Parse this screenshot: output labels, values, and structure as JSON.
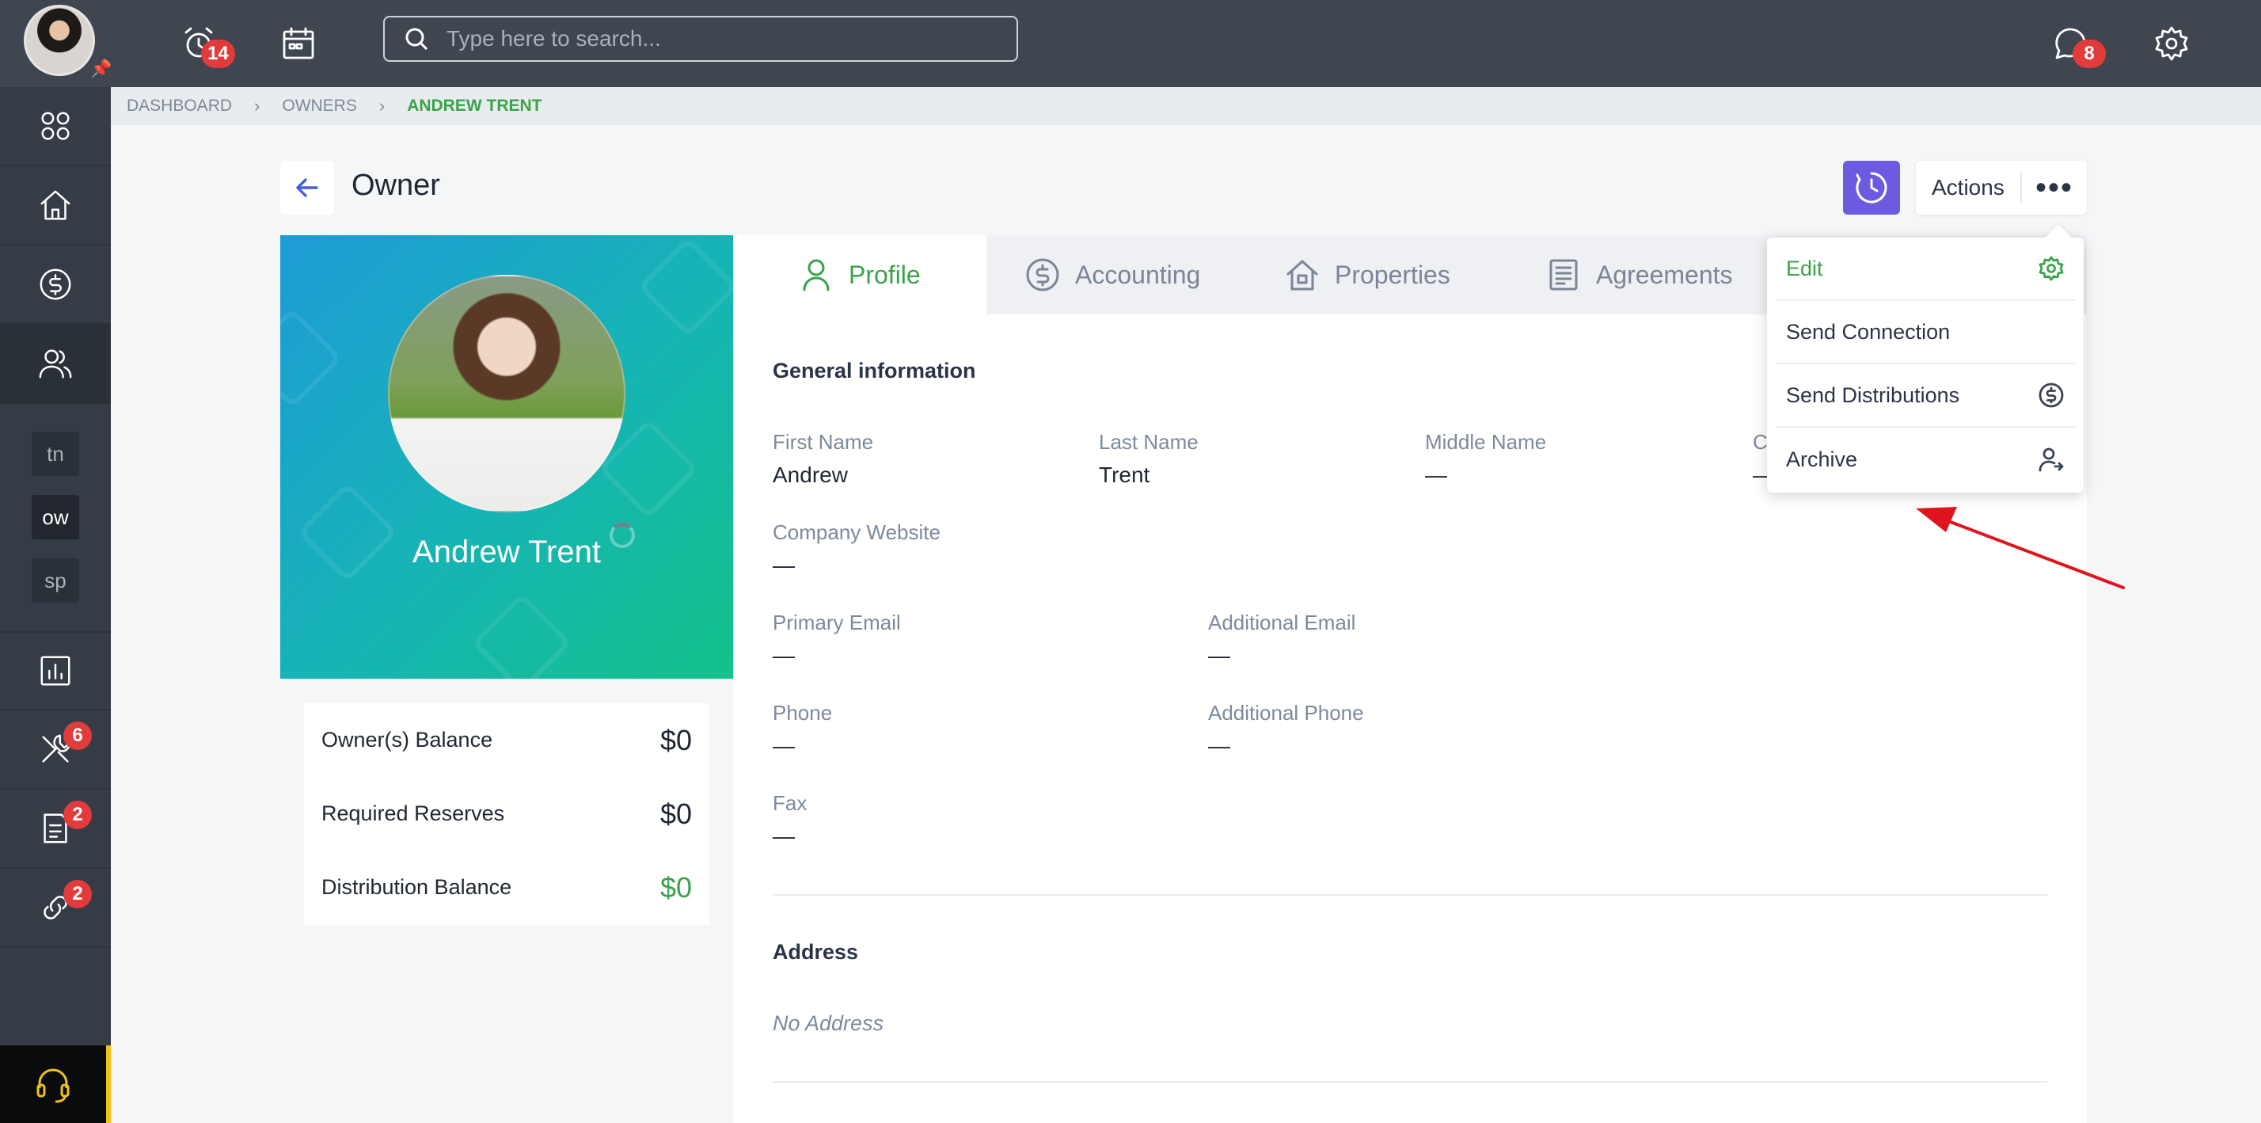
{
  "topbar": {
    "search_placeholder": "Type here to search...",
    "alarm_badge": "14",
    "chat_badge": "8"
  },
  "sidebar": {
    "abbr": [
      "tn",
      "ow",
      "sp"
    ],
    "tools_badge": "6",
    "docs_badge": "2",
    "links_badge": "2"
  },
  "breadcrumb": {
    "items": [
      "DASHBOARD",
      "OWNERS",
      "ANDREW TRENT"
    ]
  },
  "header": {
    "title": "Owner",
    "actions_label": "Actions",
    "more_label": "•••"
  },
  "profile": {
    "name": "Andrew Trent"
  },
  "balances": [
    {
      "label": "Owner(s) Balance",
      "value": "$0"
    },
    {
      "label": "Required Reserves",
      "value": "$0"
    },
    {
      "label": "Distribution Balance",
      "value": "$0"
    }
  ],
  "tabs": [
    {
      "label": "Profile"
    },
    {
      "label": "Accounting"
    },
    {
      "label": "Properties"
    },
    {
      "label": "Agreements"
    }
  ],
  "general": {
    "title": "General information",
    "first_name_label": "First Name",
    "first_name": "Andrew",
    "last_name_label": "Last Name",
    "last_name": "Trent",
    "middle_name_label": "Middle Name",
    "middle_name": "—",
    "truncated_label": "C",
    "truncated_value": "—",
    "company_website_label": "Company Website",
    "company_website": "—",
    "primary_email_label": "Primary Email",
    "primary_email": "—",
    "additional_email_label": "Additional Email",
    "additional_email": "—",
    "phone_label": "Phone",
    "phone": "—",
    "additional_phone_label": "Additional Phone",
    "additional_phone": "—",
    "fax_label": "Fax",
    "fax": "—"
  },
  "address": {
    "title": "Address",
    "empty": "No Address"
  },
  "dropdown": {
    "items": [
      {
        "label": "Edit"
      },
      {
        "label": "Send Connection"
      },
      {
        "label": "Send Distributions"
      },
      {
        "label": "Archive"
      }
    ]
  },
  "colors": {
    "accent_green": "#3aa34a",
    "badge_red": "#e23b3b",
    "clock_button": "#6b5be0",
    "annotation_arrow": "#e0141c"
  }
}
